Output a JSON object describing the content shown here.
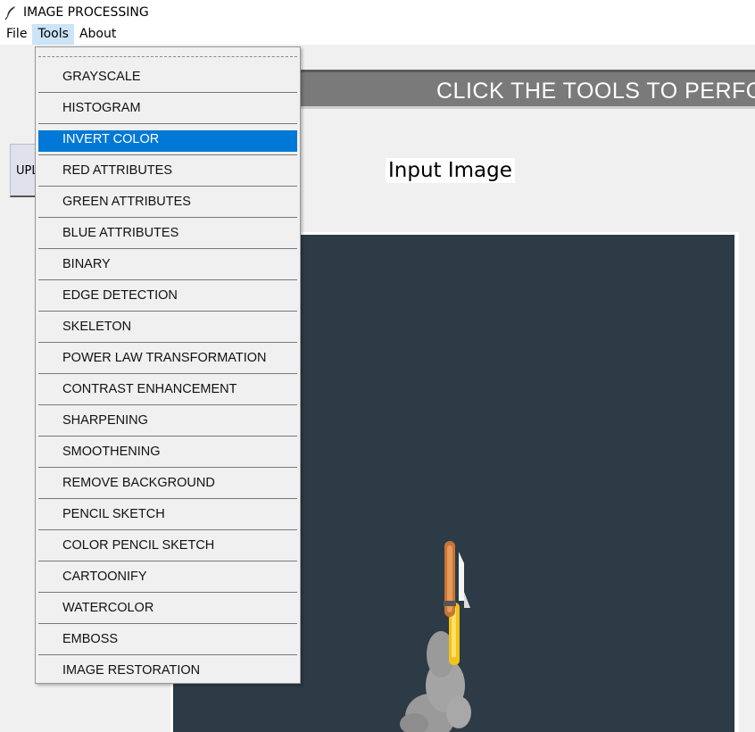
{
  "window": {
    "title": "IMAGE PROCESSING",
    "icon": "feather-icon"
  },
  "menubar": {
    "items": [
      "File",
      "Tools",
      "About"
    ],
    "active": "Tools"
  },
  "banner": {
    "text": "CLICK THE TOOLS TO PERFO"
  },
  "upload_button": {
    "label": "UPL"
  },
  "input_image": {
    "label": "Input Image"
  },
  "tools_menu": {
    "highlighted": "INVERT COLOR",
    "items": [
      "GRAYSCALE",
      "HISTOGRAM",
      "INVERT COLOR",
      "RED ATTRIBUTES",
      "GREEN ATTRIBUTES",
      "BLUE ATTRIBUTES",
      "BINARY",
      "EDGE DETECTION",
      "SKELETON",
      "POWER LAW TRANSFORMATION",
      "CONTRAST ENHANCEMENT",
      "SHARPENING",
      "SMOOTHENING",
      "REMOVE BACKGROUND",
      "PENCIL SKETCH",
      "COLOR PENCIL SKETCH",
      "CARTOONIFY",
      "WATERCOLOR",
      "EMBOSS",
      "IMAGE RESTORATION"
    ]
  },
  "colors": {
    "highlight": "#0078d7",
    "canvas_bg": "#2c3b46",
    "banner_bg": "#7a7a7a"
  }
}
